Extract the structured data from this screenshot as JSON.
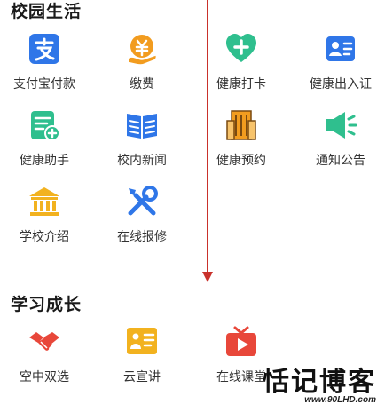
{
  "sections": {
    "campus_life": {
      "title": "校园生活"
    },
    "study_growth": {
      "title": "学习成长"
    }
  },
  "campus_life_items": [
    {
      "label": "支付宝付款",
      "icon": "alipay-icon",
      "color": "#2f76e8"
    },
    {
      "label": "缴费",
      "icon": "payment-icon",
      "color": "#f29c1f"
    },
    {
      "label": "健康打卡",
      "icon": "health-checkin-icon",
      "color": "#2fbf8e"
    },
    {
      "label": "健康出入证",
      "icon": "health-pass-icon",
      "color": "#2f76e8"
    },
    {
      "label": "健康助手",
      "icon": "health-assistant-icon",
      "color": "#2fbf8e"
    },
    {
      "label": "校内新闻",
      "icon": "news-icon",
      "color": "#2f76e8"
    },
    {
      "label": "健康预约",
      "icon": "building-icon",
      "color": "#f29c1f"
    },
    {
      "label": "通知公告",
      "icon": "megaphone-icon",
      "color": "#2fbf8e"
    },
    {
      "label": "学校介绍",
      "icon": "school-icon",
      "color": "#f2b21f"
    },
    {
      "label": "在线报修",
      "icon": "repair-icon",
      "color": "#2f76e8"
    }
  ],
  "study_items": [
    {
      "label": "空中双选",
      "icon": "handshake-icon",
      "color": "#e8473a"
    },
    {
      "label": "云宣讲",
      "icon": "presentation-icon",
      "color": "#f2b21f"
    },
    {
      "label": "在线课堂",
      "icon": "online-class-icon",
      "color": "#e8473a"
    }
  ],
  "watermark": {
    "title": "恬记博客",
    "url": "www.90LHD.com"
  }
}
